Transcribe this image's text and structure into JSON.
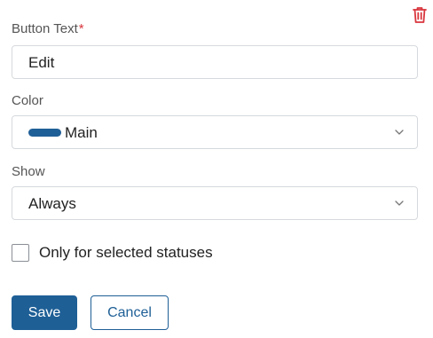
{
  "form": {
    "button_text": {
      "label": "Button Text",
      "required_mark": "*",
      "value": "Edit"
    },
    "color": {
      "label": "Color",
      "value": "Main",
      "swatch_color": "#1f5f97"
    },
    "show": {
      "label": "Show",
      "value": "Always"
    },
    "only_selected_statuses": {
      "label": "Only for selected statuses",
      "checked": false
    },
    "actions": {
      "save_label": "Save",
      "cancel_label": "Cancel"
    }
  },
  "icons": {
    "delete": "trash-icon",
    "dropdown": "chevron-down-icon"
  },
  "colors": {
    "accent": "#1e5f96",
    "delete_icon": "#d9363e",
    "border": "#d6d9dd"
  }
}
